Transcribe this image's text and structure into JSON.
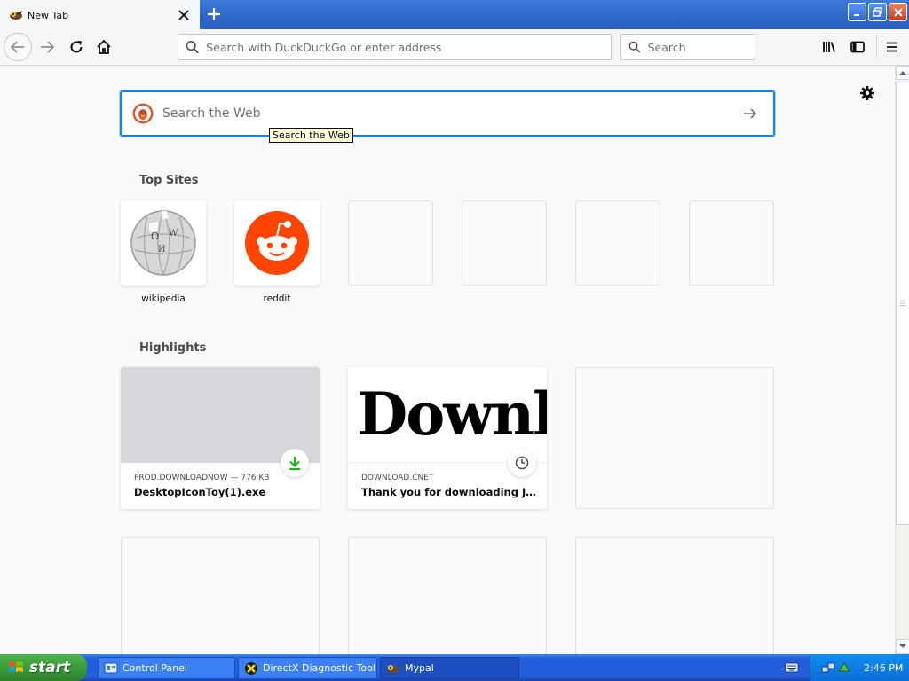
{
  "window": {
    "tab_title": "New Tab"
  },
  "navbar": {
    "url_placeholder": "Search with DuckDuckGo or enter address",
    "search_placeholder": "Search"
  },
  "newtab": {
    "search_placeholder": "Search the Web",
    "search_tooltip": "Search the Web",
    "top_sites_title": "Top Sites",
    "top_sites": [
      {
        "label": "wikipedia"
      },
      {
        "label": "reddit"
      }
    ],
    "highlights_title": "Highlights",
    "highlights": [
      {
        "host": "PROD.DOWNLOADNOW — 776 KB",
        "title": "DesktopIconToy(1).exe"
      },
      {
        "host": "DOWNLOAD.CNET",
        "title": "Thank you for downloading Jeff'...",
        "preview_text": "Downl"
      }
    ]
  },
  "taskbar": {
    "start_label": "start",
    "tasks": [
      {
        "label": "Control Panel"
      },
      {
        "label": "DirectX Diagnostic Tool"
      },
      {
        "label": "Mypal"
      }
    ],
    "clock": "2:46 PM"
  },
  "colors": {
    "accent": "#0a84ff",
    "reddit": "#ff4500",
    "download_green": "#12bc00"
  }
}
